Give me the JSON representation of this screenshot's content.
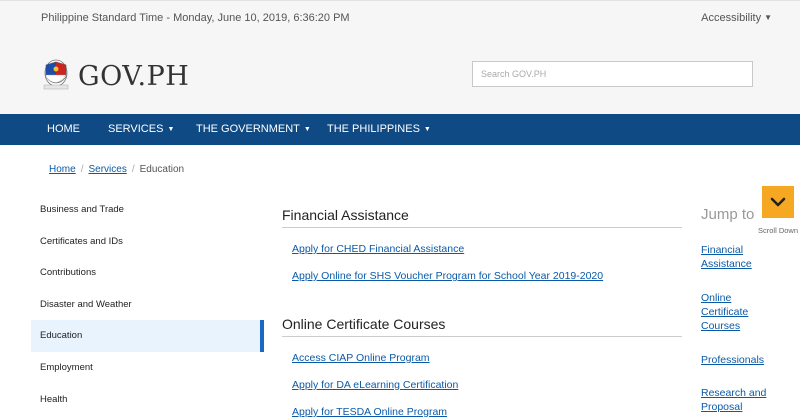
{
  "header": {
    "time": "Philippine Standard Time - Monday, June 10, 2019, 6:36:20 PM",
    "accessibility": "Accessibility",
    "logo": "GOV.PH",
    "search_placeholder": "Search GOV.PH"
  },
  "nav": {
    "home": "HOME",
    "services": "SERVICES",
    "government": "THE GOVERNMENT",
    "philippines": "THE PHILIPPINES"
  },
  "breadcrumb": {
    "home": "Home",
    "services": "Services",
    "current": "Education"
  },
  "sidebar": [
    "Business and Trade",
    "Certificates and IDs",
    "Contributions",
    "Disaster and Weather",
    "Education",
    "Employment",
    "Health"
  ],
  "main": {
    "financial_title": "Financial Assistance",
    "financial_links": [
      "Apply for CHED Financial Assistance",
      "Apply Online for SHS Voucher Program for School Year 2019-2020"
    ],
    "courses_title": "Online Certificate Courses",
    "courses_links": [
      "Access CIAP Online Program",
      "Apply for DA eLearning Certification",
      "Apply for TESDA Online Program"
    ]
  },
  "jump": {
    "title": "Jump to",
    "financial": "Financial Assistance",
    "online": "Online Certificate Courses",
    "professionals": "Professionals",
    "research": "Research and Proposal"
  },
  "scroll": {
    "label": "Scroll Down"
  },
  "colors": {
    "nav": "#0f4a84",
    "link": "#0a5aa8",
    "scroll_button": "#f7a823",
    "active_sidebar": "#1a67c4"
  }
}
